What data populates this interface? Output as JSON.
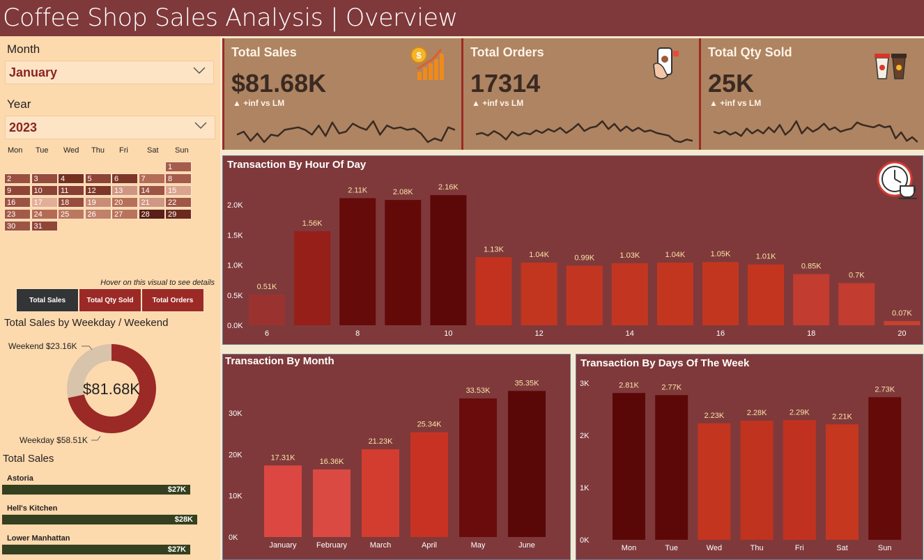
{
  "header": {
    "title": "Coffee Shop Sales Analysis | Overview"
  },
  "colors": {
    "header_bg": "#7f393b",
    "sidebar_bg": "#fdd9ae",
    "kpi_bg": "#ae8462",
    "panel_bg": "#7f393b",
    "value_label": "#fbe3a6",
    "store_bar": "#34401f"
  },
  "filters": {
    "month": {
      "label": "Month",
      "value": "January"
    },
    "year": {
      "label": "Year",
      "value": "2023"
    }
  },
  "calendar": {
    "weekdays": [
      "Mon",
      "Tue",
      "Wed",
      "Thu",
      "Fri",
      "Sat",
      "Sun"
    ],
    "days": [
      {
        "d": "1",
        "c": "#a65c4c"
      },
      {
        "d": "2",
        "c": "#9b4f41"
      },
      {
        "d": "3",
        "c": "#944a3d"
      },
      {
        "d": "4",
        "c": "#733021"
      },
      {
        "d": "5",
        "c": "#8d4336"
      },
      {
        "d": "6",
        "c": "#7d3628"
      },
      {
        "d": "7",
        "c": "#b46c57"
      },
      {
        "d": "8",
        "c": "#a45b4b"
      },
      {
        "d": "9",
        "c": "#8e4536"
      },
      {
        "d": "10",
        "c": "#8c4335"
      },
      {
        "d": "11",
        "c": "#874033"
      },
      {
        "d": "12",
        "c": "#7d3629"
      },
      {
        "d": "13",
        "c": "#cf9583"
      },
      {
        "d": "14",
        "c": "#9e5546"
      },
      {
        "d": "15",
        "c": "#d9a38e"
      },
      {
        "d": "16",
        "c": "#9c5344"
      },
      {
        "d": "17",
        "c": "#e2ae98"
      },
      {
        "d": "18",
        "c": "#974d3f"
      },
      {
        "d": "19",
        "c": "#c98c77"
      },
      {
        "d": "20",
        "c": "#b67059"
      },
      {
        "d": "21",
        "c": "#cf9784"
      },
      {
        "d": "22",
        "c": "#a05747"
      },
      {
        "d": "23",
        "c": "#a35a4a"
      },
      {
        "d": "24",
        "c": "#b36b55"
      },
      {
        "d": "25",
        "c": "#bb7860"
      },
      {
        "d": "26",
        "c": "#c08069"
      },
      {
        "d": "27",
        "c": "#b8735d"
      },
      {
        "d": "28",
        "c": "#5a1f16"
      },
      {
        "d": "29",
        "c": "#6b2a1d"
      },
      {
        "d": "30",
        "c": "#9d5445"
      },
      {
        "d": "31",
        "c": "#8f4638"
      }
    ],
    "first_day_offset": 6
  },
  "hint": "Hover on this visual to see details",
  "toggles": [
    {
      "label": "Total Sales",
      "bg": "#333436",
      "active": true
    },
    {
      "label": "Total Qty Sold",
      "bg": "#9b2a26",
      "active": false
    },
    {
      "label": "Total Orders",
      "bg": "#9b2a26",
      "active": false
    }
  ],
  "kpis": [
    {
      "title": "Total Sales",
      "value": "$81.68K",
      "delta": "▲ +inf vs LM",
      "icon": "sales-growth-icon",
      "spark": [
        60,
        55,
        70,
        58,
        72,
        60,
        62,
        52,
        50,
        48,
        52,
        60,
        45,
        62,
        40,
        58,
        55,
        42,
        48,
        52,
        38,
        60,
        45,
        50,
        48,
        52,
        50,
        58,
        72,
        66,
        70,
        48,
        52
      ]
    },
    {
      "title": "Total Orders",
      "value": "17314",
      "delta": "▲ +inf vs LM",
      "icon": "mobile-order-icon",
      "spark": [
        60,
        58,
        62,
        55,
        60,
        68,
        56,
        62,
        58,
        60,
        54,
        58,
        52,
        56,
        50,
        58,
        52,
        44,
        55,
        50,
        48,
        40,
        52,
        44,
        55,
        48,
        55,
        50,
        56,
        54,
        58,
        60,
        62,
        70,
        72,
        68,
        70
      ]
    },
    {
      "title": "Total Qty Sold",
      "value": "25K",
      "delta": "▲ +inf vs LM",
      "icon": "coffee-cups-icon",
      "spark": [
        55,
        58,
        54,
        60,
        56,
        62,
        50,
        58,
        52,
        58,
        48,
        56,
        44,
        60,
        52,
        38,
        58,
        48,
        55,
        50,
        42,
        52,
        48,
        55,
        52,
        50,
        40,
        44,
        46,
        48,
        44,
        48,
        46,
        66,
        56,
        70,
        64,
        72
      ]
    }
  ],
  "donut": {
    "title": "Total Sales by Weekday / Weekend",
    "center": "$81.68K",
    "weekend_label": "Weekend $23.16K",
    "weekday_label": "Weekday $58.51K",
    "weekend_value": 23.16,
    "weekday_value": 58.51,
    "weekend_color": "#d8c3ab",
    "weekday_color": "#9b2a26"
  },
  "stores": {
    "title": "Total Sales",
    "items": [
      {
        "name": "Astoria",
        "label": "$27K",
        "value": 27
      },
      {
        "name": "Hell's Kitchen",
        "label": "$28K",
        "value": 28
      },
      {
        "name": "Lower Manhattan",
        "label": "$27K",
        "value": 27
      }
    ]
  },
  "chart_data": [
    {
      "type": "bar",
      "title": "Transaction By Hour Of Day",
      "categories": [
        6,
        7,
        8,
        9,
        10,
        11,
        12,
        13,
        14,
        15,
        16,
        17,
        18,
        19,
        20
      ],
      "x_tick_labels": [
        "6",
        "8",
        "10",
        "12",
        "14",
        "16",
        "18",
        "20"
      ],
      "values": [
        0.51,
        1.56,
        2.11,
        2.08,
        2.16,
        1.13,
        1.04,
        0.99,
        1.03,
        1.04,
        1.05,
        1.01,
        0.85,
        0.7,
        0.07
      ],
      "labels": [
        "0.51K",
        "1.56K",
        "2.11K",
        "2.08K",
        "2.16K",
        "1.13K",
        "1.04K",
        "0.99K",
        "1.03K",
        "1.04K",
        "1.05K",
        "1.01K",
        "0.85K",
        "0.7K",
        "0.07K"
      ],
      "colors": [
        "#9a3330",
        "#961f1a",
        "#650b09",
        "#630a09",
        "#5d0808",
        "#c3321f",
        "#c23620",
        "#c23621",
        "#c23621",
        "#c23620",
        "#c23620",
        "#c3351f",
        "#c23c30",
        "#c23c30",
        "#c5422f"
      ],
      "y_ticks": [
        "0.0K",
        "0.5K",
        "1.0K",
        "1.5K",
        "2.0K"
      ],
      "ylim": [
        0,
        2.4
      ]
    },
    {
      "type": "bar",
      "title": "Transaction By Month",
      "categories": [
        "January",
        "February",
        "March",
        "April",
        "May",
        "June"
      ],
      "values": [
        17.31,
        16.36,
        21.23,
        25.34,
        33.53,
        35.35
      ],
      "labels": [
        "17.31K",
        "16.36K",
        "21.23K",
        "25.34K",
        "33.53K",
        "35.35K"
      ],
      "colors": [
        "#dc4841",
        "#da4a43",
        "#d23d30",
        "#c83223",
        "#6a0c0c",
        "#5a0707"
      ],
      "y_ticks": [
        "0K",
        "10K",
        "20K",
        "30K"
      ],
      "ylim": [
        0,
        38
      ]
    },
    {
      "type": "bar",
      "title": "Transaction By Days Of The Week",
      "categories": [
        "Mon",
        "Tue",
        "Wed",
        "Thu",
        "Fri",
        "Sat",
        "Sun"
      ],
      "values": [
        2.81,
        2.77,
        2.23,
        2.28,
        2.29,
        2.21,
        2.73
      ],
      "labels": [
        "2.81K",
        "2.77K",
        "2.23K",
        "2.28K",
        "2.29K",
        "2.21K",
        "2.73K"
      ],
      "colors": [
        "#5a0707",
        "#5d0808",
        "#c3351f",
        "#c0331f",
        "#c0321f",
        "#c5371f",
        "#640b0a"
      ],
      "y_ticks": [
        "0K",
        "1K",
        "2K",
        "3K"
      ],
      "ylim": [
        0,
        3.05
      ]
    }
  ]
}
